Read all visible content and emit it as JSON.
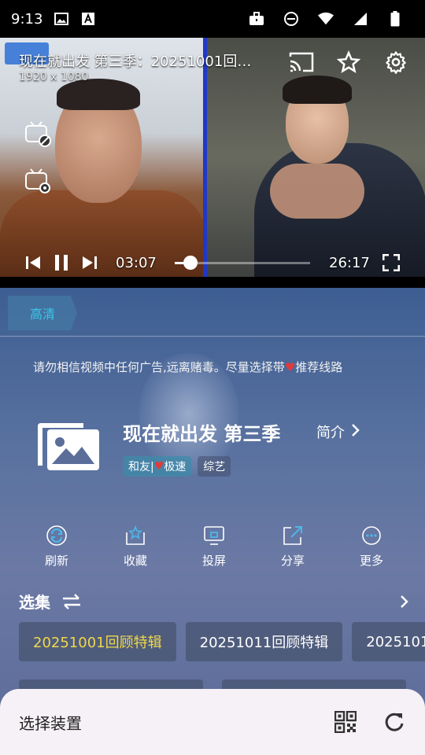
{
  "status_bar": {
    "time": "9:13"
  },
  "player": {
    "title": "现在就出发 第三季：20251001回顾特辑",
    "resolution": "1920 x 1080",
    "current_time": "03:07",
    "total_time": "26:17",
    "progress": 0.119
  },
  "quality": {
    "label": "高清"
  },
  "notice": {
    "text_before": "请勿相信视频中任何广告,远离赌毒。尽量选择带",
    "heart": "♥",
    "text_after": "推荐线路"
  },
  "show": {
    "title": "现在就出发 第三季",
    "intro_label": "简介",
    "route_tag_prefix": "和友|",
    "route_tag_heart": "♥",
    "route_tag_suffix": "极速",
    "genre_tag": "综艺"
  },
  "actions": [
    {
      "label": "刷新"
    },
    {
      "label": "收藏"
    },
    {
      "label": "投屏"
    },
    {
      "label": "分享"
    },
    {
      "label": "更多"
    }
  ],
  "episodes": {
    "header": "选集",
    "items": [
      "20251001回顾特辑",
      "20251011回顾特辑",
      "2025101"
    ]
  },
  "device_sheet": {
    "title": "选择装置"
  },
  "colors": {
    "accent_active_episode": "#f0d84a",
    "quality_tab_text": "#3ec6e8",
    "heart": "#e23a3a"
  }
}
